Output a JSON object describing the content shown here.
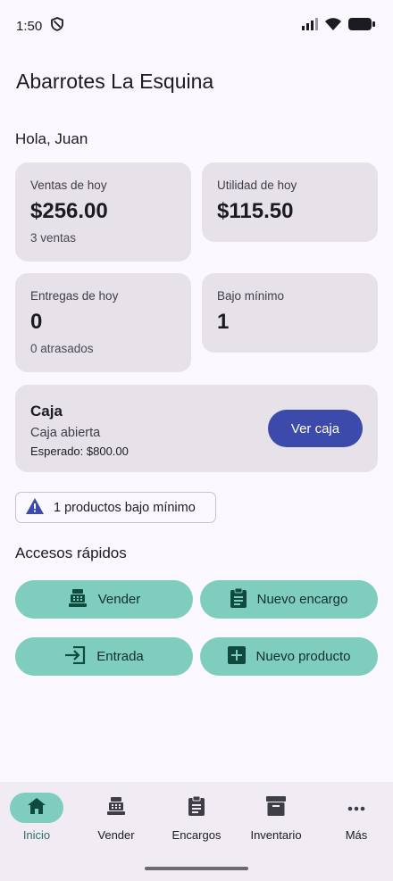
{
  "status_bar": {
    "time": "1:50"
  },
  "app_title": "Abarrotes La Esquina",
  "greeting": "Hola, Juan",
  "cards": {
    "sales": {
      "label": "Ventas de hoy",
      "value": "$256.00",
      "sub": "3 ventas"
    },
    "profit": {
      "label": "Utilidad de hoy",
      "value": "$115.50"
    },
    "deliveries": {
      "label": "Entregas de hoy",
      "value": "0",
      "sub": "0 atrasados"
    },
    "low_stock": {
      "label": "Bajo mínimo",
      "value": "1"
    }
  },
  "caja": {
    "title": "Caja",
    "status": "Caja abierta",
    "expected": "Esperado: $800.00",
    "button": "Ver caja"
  },
  "alert": {
    "text": "1 productos bajo mínimo"
  },
  "quick_access": {
    "title": "Accesos rápidos",
    "sell": "Vender",
    "new_order": "Nuevo encargo",
    "entry": "Entrada",
    "new_product": "Nuevo producto"
  },
  "nav": {
    "home": "Inicio",
    "sell": "Vender",
    "orders": "Encargos",
    "inventory": "Inventario",
    "more": "Más"
  },
  "colors": {
    "accent_primary": "#3c4bab",
    "accent_teal": "#7fcdbf",
    "card_bg": "#e7e1ea",
    "icon_dark": "#0f4a3f"
  }
}
